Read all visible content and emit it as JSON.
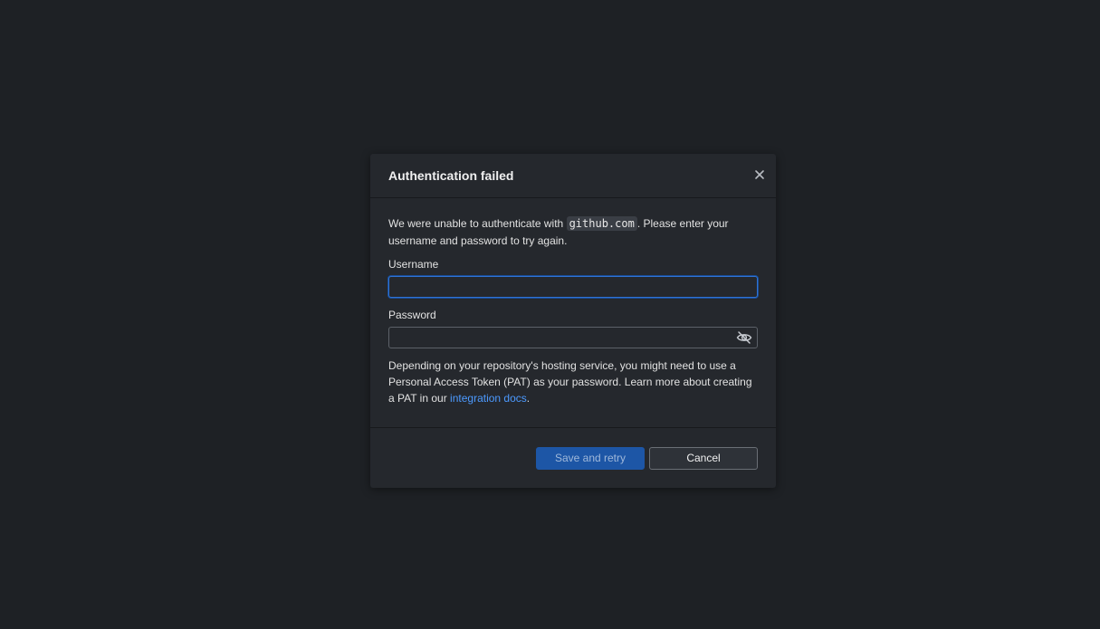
{
  "dialog": {
    "title": "Authentication failed",
    "intro_before": "We were unable to authenticate with ",
    "host": "github.com",
    "intro_after": ". Please enter your username and password to try again.",
    "username_label": "Username",
    "username_value": "",
    "password_label": "Password",
    "password_value": "",
    "help_text": "Depending on your repository's hosting service, you might need to use a Personal Access Token (PAT) as your password. Learn more about creating a PAT in our ",
    "help_link": "integration docs",
    "help_end": ".",
    "primary_button": "Save and retry",
    "cancel_button": "Cancel"
  },
  "icons": {
    "close": "close-icon",
    "password_visibility": "eye-off-icon"
  },
  "colors": {
    "background": "#1e2125",
    "dialog": "#25282d",
    "primary": "#1d56a6",
    "link": "#4c9aff",
    "focus": "#2f73d4"
  }
}
